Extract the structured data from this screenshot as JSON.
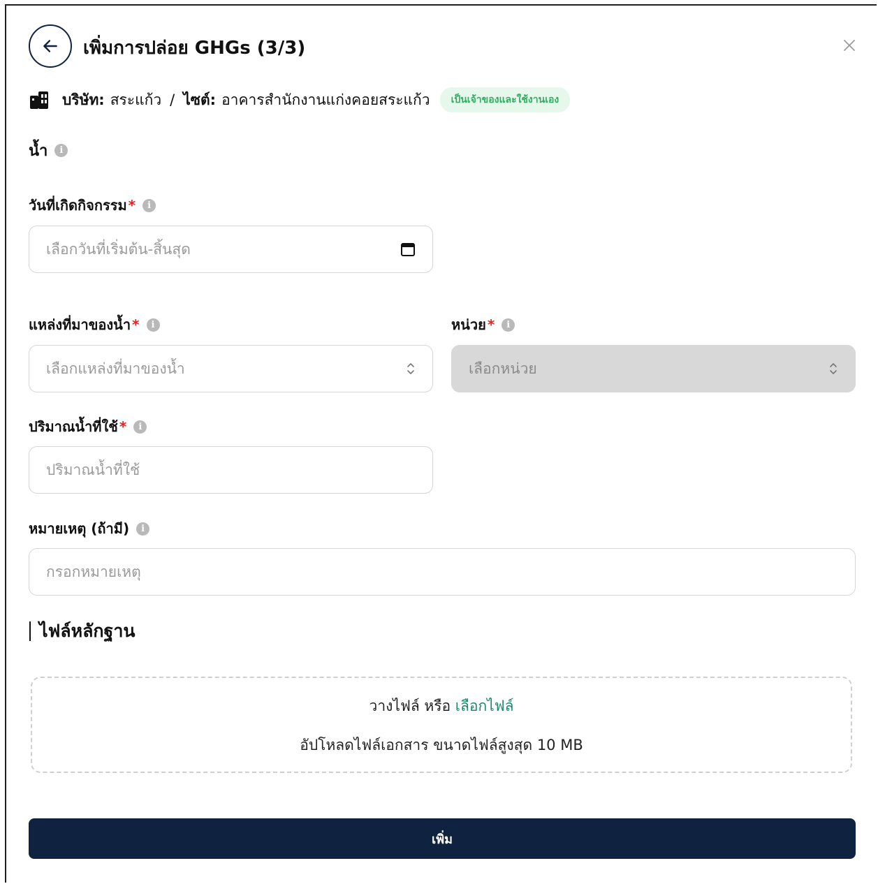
{
  "header": {
    "title": "เพิ่มการปล่อย GHGs (3/3)"
  },
  "company": {
    "company_label": "บริษัท:",
    "company_value": "สระแก้ว",
    "separator": "/",
    "site_label": "ไซต์:",
    "site_value": "อาคารสำนักงานแก่งคอยสระแก้ว",
    "badge": "เป็นเจ้าของและใช้งานเอง"
  },
  "section": {
    "title": "น้ำ"
  },
  "form": {
    "activity_date": {
      "label": "วันที่เกิดกิจกรรม",
      "placeholder": "เลือกวันที่เริ่มต้น-สิ้นสุด"
    },
    "water_source": {
      "label": "แหล่งที่มาของน้ำ",
      "placeholder": "เลือกแหล่งที่มาของน้ำ"
    },
    "unit": {
      "label": "หน่วย",
      "placeholder": "เลือกหน่วย"
    },
    "water_amount": {
      "label": "ปริมาณน้ำที่ใช้",
      "placeholder": "ปริมาณน้ำที่ใช้"
    },
    "note": {
      "label": "หมายเหตุ (ถ้ามี)",
      "placeholder": "กรอกหมายเหตุ"
    }
  },
  "evidence": {
    "title": "ไฟล์หลักฐาน",
    "drop_text": "วางไฟล์ หรือ",
    "choose_link": "เลือกไฟล์",
    "hint": "อัปโหลดไฟล์เอกสาร ขนาดไฟล์สูงสุด 10 MB"
  },
  "actions": {
    "submit_label": "เพิ่ม"
  },
  "icons": {
    "back": "arrow-left-icon",
    "close": "close-icon",
    "building": "building-icon",
    "info": "info-icon",
    "calendar": "calendar-icon",
    "select": "chevron-up-down-icon"
  },
  "colors": {
    "primary": "#0f2340",
    "badge_bg": "#e6f7ec",
    "badge_text": "#2fae5f",
    "link": "#1a8a6a",
    "required": "#e02424"
  }
}
